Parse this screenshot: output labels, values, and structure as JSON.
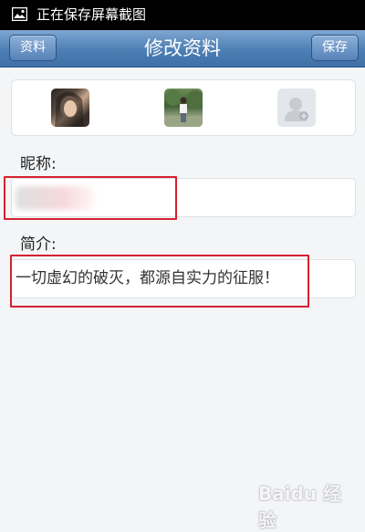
{
  "status_bar": {
    "text": "正在保存屏幕截图"
  },
  "nav": {
    "left_button": "资料",
    "title": "修改资料",
    "right_button": "保存"
  },
  "avatars": [
    {
      "icon": "photo-avatar"
    },
    {
      "icon": "photo-avatar"
    },
    {
      "icon": "add-avatar-placeholder"
    }
  ],
  "nickname": {
    "label": "昵称:",
    "value": ""
  },
  "bio": {
    "label": "简介:",
    "value": "一切虚幻的破灭，都源自实力的征服！"
  },
  "watermark": {
    "text": "Baidu 经验"
  },
  "colors": {
    "nav_bar": "#4d7fb5",
    "highlight_box": "#d5222f",
    "background": "#f3f5f7"
  }
}
